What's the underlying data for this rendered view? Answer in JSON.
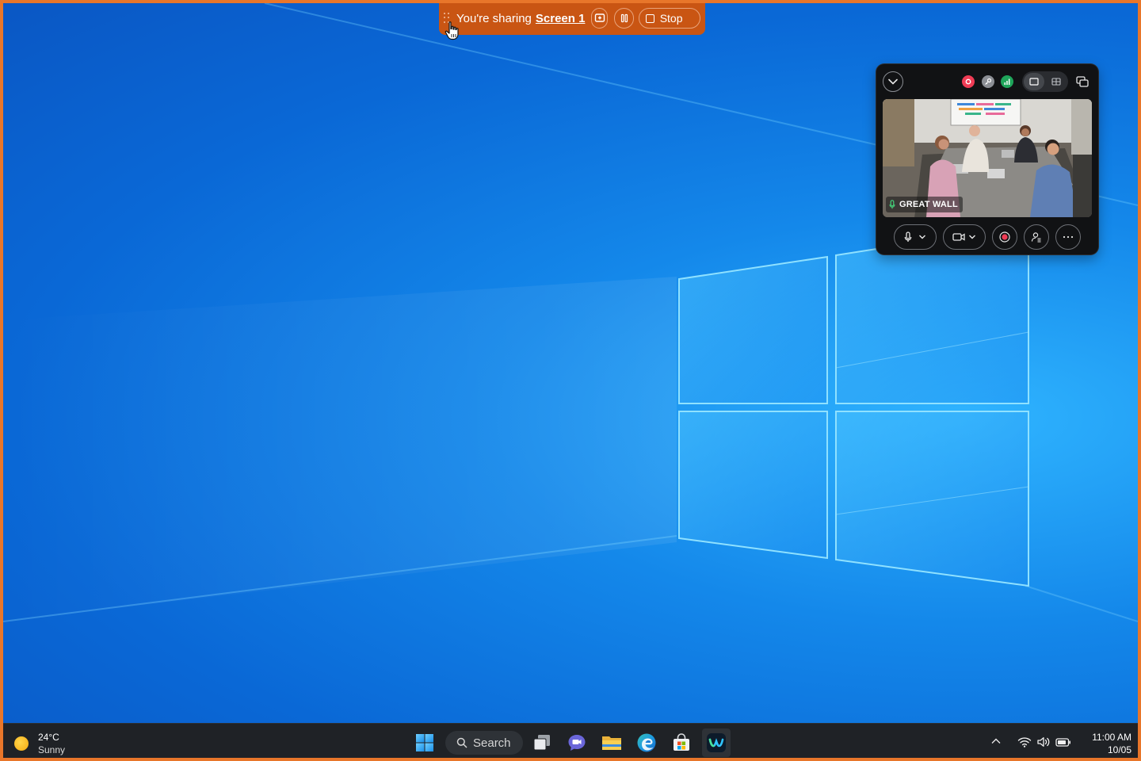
{
  "share_bar": {
    "text": "You're sharing",
    "screen_link": "Screen 1",
    "stop_label": "Stop"
  },
  "meeting": {
    "participant_name": "GREAT WALL"
  },
  "taskbar": {
    "weather_temp": "24°C",
    "weather_condition": "Sunny",
    "search_label": "Search",
    "clock_time": "11:00 AM",
    "clock_date": "10/05"
  },
  "colors": {
    "share_bar": "#c95513",
    "screen_border": "#e8762a",
    "recording_dot": "#f03c55",
    "signal_dot": "#1fa55a"
  },
  "icons": {
    "taskbar_apps": [
      "start-icon",
      "search-icon",
      "task-view-icon",
      "meet-chat-icon",
      "file-explorer-icon",
      "edge-icon",
      "store-icon",
      "webex-icon"
    ],
    "tray": [
      "chevron-up-icon",
      "wifi-icon",
      "volume-icon",
      "battery-icon"
    ],
    "meeting_controls": [
      "microphone-icon",
      "camera-icon",
      "record-icon",
      "participants-icon",
      "more-icon"
    ]
  }
}
